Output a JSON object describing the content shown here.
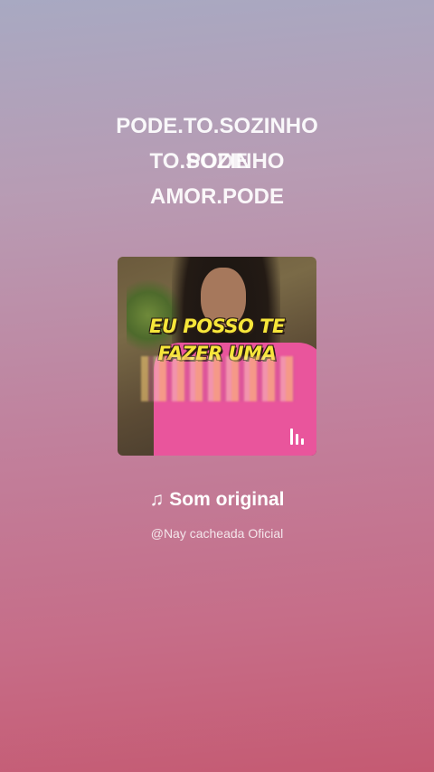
{
  "lyrics": {
    "line1": "PODE.TO.SOZINHO",
    "line2a": "TO.SOZINHO",
    "line2b": "PODE",
    "line3": "AMOR.PODE"
  },
  "cover": {
    "caption_line1": "EU POSSO TE",
    "caption_line2": "FAZER UMA",
    "playing_icon": "equalizer-bars-icon"
  },
  "track": {
    "note_icon": "♫",
    "title": "Som original",
    "artist": "@Nay cacheada Oficial"
  },
  "colors": {
    "background_top": "#a8a9c2",
    "background_bottom": "#c55a72",
    "caption_yellow": "#f6e63a",
    "shirt_pink": "#e9559c"
  }
}
